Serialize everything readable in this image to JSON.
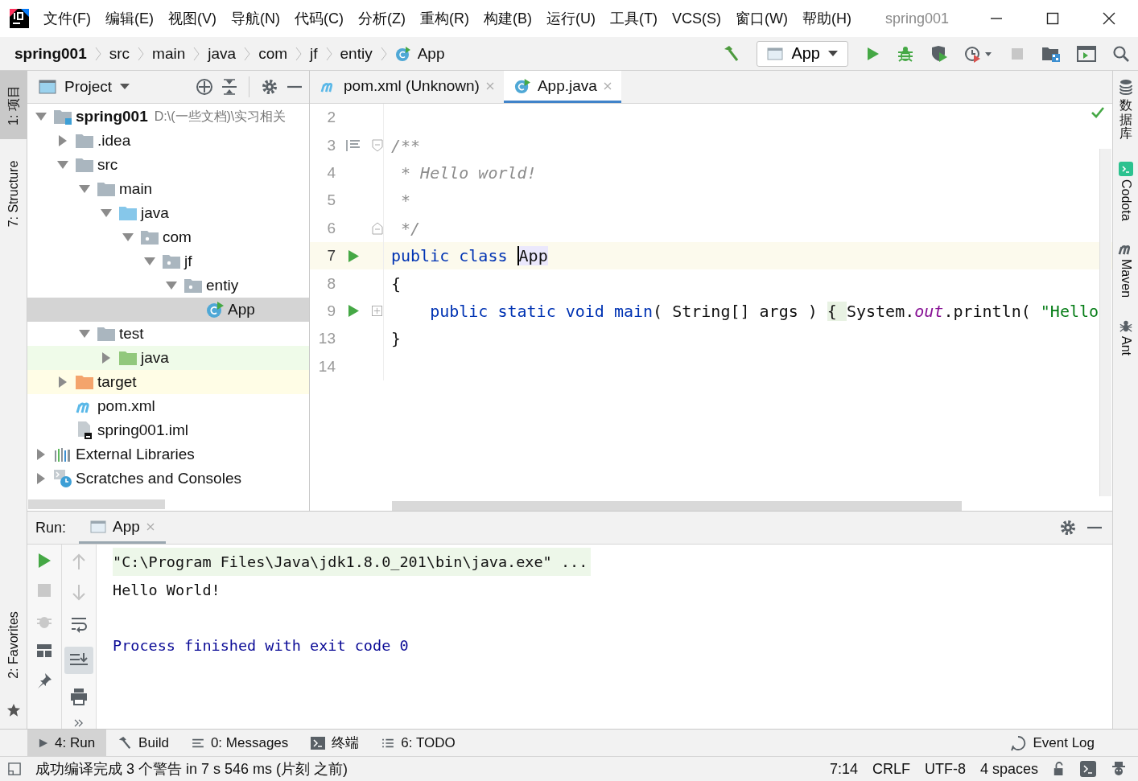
{
  "title_bar": {
    "menu": [
      "文件(F)",
      "编辑(E)",
      "视图(V)",
      "导航(N)",
      "代码(C)",
      "分析(Z)",
      "重构(R)",
      "构建(B)",
      "运行(U)",
      "工具(T)",
      "VCS(S)",
      "窗口(W)",
      "帮助(H)"
    ],
    "title": "spring001"
  },
  "navigation_bar": {
    "breadcrumbs": [
      {
        "label": "spring001",
        "kind": "project"
      },
      {
        "label": "src",
        "kind": "folder"
      },
      {
        "label": "main",
        "kind": "folder"
      },
      {
        "label": "java",
        "kind": "folder"
      },
      {
        "label": "com",
        "kind": "folder"
      },
      {
        "label": "jf",
        "kind": "folder"
      },
      {
        "label": "entiy",
        "kind": "folder"
      },
      {
        "label": "App",
        "kind": "class"
      }
    ],
    "run_configuration": "App"
  },
  "left_tool_windows": [
    {
      "label": "1: 项目",
      "selected": true
    },
    {
      "label": "7: Structure",
      "selected": false
    }
  ],
  "favorites": {
    "label": "2: Favorites"
  },
  "project_panel": {
    "title": "Project",
    "tree": [
      {
        "label": "spring001",
        "detail": "D:\\(一些文档)\\实习相关",
        "kind": "module",
        "expanded": true,
        "selected": false,
        "children": [
          {
            "label": ".idea",
            "kind": "folder",
            "expanded": false,
            "selected": false
          },
          {
            "label": "src",
            "kind": "folder",
            "expanded": true,
            "selected": false,
            "children": [
              {
                "label": "main",
                "kind": "folder",
                "expanded": true,
                "selected": false,
                "children": [
                  {
                    "label": "java",
                    "kind": "source_root",
                    "expanded": true,
                    "selected": false,
                    "children": [
                      {
                        "label": "com",
                        "kind": "package",
                        "expanded": true,
                        "selected": false,
                        "children": [
                          {
                            "label": "jf",
                            "kind": "package",
                            "expanded": true,
                            "selected": false,
                            "children": [
                              {
                                "label": "entiy",
                                "kind": "package",
                                "expanded": true,
                                "selected": false,
                                "children": [
                                  {
                                    "label": "App",
                                    "kind": "class",
                                    "selected": true
                                  }
                                ]
                              }
                            ]
                          }
                        ]
                      }
                    ]
                  }
                ]
              },
              {
                "label": "test",
                "kind": "folder",
                "expanded": true,
                "selected": false,
                "children": [
                  {
                    "label": "java",
                    "kind": "test_root",
                    "expanded": false,
                    "selected": false
                  }
                ]
              }
            ]
          },
          {
            "label": "target",
            "kind": "excluded",
            "expanded": false,
            "selected": false
          },
          {
            "label": "pom.xml",
            "kind": "maven",
            "selected": false
          },
          {
            "label": "spring001.iml",
            "kind": "iml",
            "selected": false
          }
        ]
      },
      {
        "label": "External Libraries",
        "kind": "libraries",
        "expanded": false,
        "selected": false
      },
      {
        "label": "Scratches and Consoles",
        "kind": "scratches",
        "expanded": false,
        "selected": false
      }
    ]
  },
  "editor": {
    "tabs": [
      {
        "label": "pom.xml (Unknown)",
        "kind": "maven",
        "selected": false
      },
      {
        "label": "App.java",
        "kind": "class",
        "selected": true
      }
    ],
    "lines": [
      {
        "number": "2",
        "current": false
      },
      {
        "number": "3",
        "current": false,
        "gutter": {
          "kind": "doc"
        },
        "fold": {
          "kind": "start"
        },
        "tokens": [
          {
            "kind": "comment",
            "text": "/**"
          }
        ]
      },
      {
        "number": "4",
        "current": false,
        "tokens": [
          {
            "kind": "comment",
            "text": " * Hello world!"
          }
        ]
      },
      {
        "number": "5",
        "current": false,
        "tokens": [
          {
            "kind": "comment",
            "text": " *"
          }
        ]
      },
      {
        "number": "6",
        "current": false,
        "fold": {
          "kind": "end"
        },
        "tokens": [
          {
            "kind": "comment",
            "text": " */"
          }
        ]
      },
      {
        "number": "7",
        "current": true,
        "gutter": {
          "kind": "run"
        },
        "tokens": [
          {
            "kind": "keyword",
            "text": "public class "
          },
          {
            "kind": "caret",
            "text": "App"
          }
        ]
      },
      {
        "number": "8",
        "current": false,
        "tokens": [
          {
            "kind": "plain",
            "text": "{"
          }
        ]
      },
      {
        "number": "9",
        "current": false,
        "gutter": {
          "kind": "run"
        },
        "fold": {
          "kind": "collapsed"
        },
        "tokens": [
          {
            "kind": "keyword",
            "text": "    public static void main"
          },
          {
            "kind": "plain",
            "text": "( String[] args ) "
          },
          {
            "kind": "folded",
            "text": "{ "
          },
          {
            "kind": "plain",
            "text": "System."
          },
          {
            "kind": "static",
            "text": "out"
          },
          {
            "kind": "plain",
            "text": ".println( "
          },
          {
            "kind": "string",
            "text": "\"Hello"
          }
        ]
      },
      {
        "number": "13",
        "current": false,
        "tokens": [
          {
            "kind": "plain",
            "text": "}"
          }
        ]
      },
      {
        "number": "14",
        "current": false
      }
    ]
  },
  "right_tool_windows": [
    {
      "label": "数据库",
      "kind": "database"
    },
    {
      "label": "Codota",
      "kind": "codota"
    },
    {
      "label": "Maven",
      "kind": "maven"
    },
    {
      "label": "Ant",
      "kind": "ant"
    }
  ],
  "run_panel": {
    "label": "Run:",
    "tabs": [
      {
        "label": "App",
        "selected": true
      }
    ],
    "console": [
      {
        "kind": "command",
        "text": "\"C:\\Program Files\\Java\\jdk1.8.0_201\\bin\\java.exe\" ..."
      },
      {
        "kind": "output",
        "text": "Hello World!"
      },
      {
        "kind": "system",
        "text": "Process finished with exit code 0"
      }
    ]
  },
  "tool_window_bar": {
    "left": [
      {
        "label": "4: Run",
        "kind": "run",
        "selected": true
      },
      {
        "label": "Build",
        "kind": "build",
        "selected": false
      },
      {
        "label": "0: Messages",
        "kind": "messages",
        "selected": false
      },
      {
        "label": "终端",
        "kind": "terminal",
        "selected": false
      },
      {
        "label": "6: TODO",
        "kind": "todo",
        "selected": false
      }
    ],
    "right": [
      {
        "label": "Event Log",
        "kind": "log",
        "selected": false
      }
    ]
  },
  "status_bar": {
    "message": "成功编译完成 3 个警告 in 7 s 546 ms (片刻 之前)",
    "items": [
      "7:14",
      "CRLF",
      "UTF-8",
      "4 spaces"
    ]
  }
}
